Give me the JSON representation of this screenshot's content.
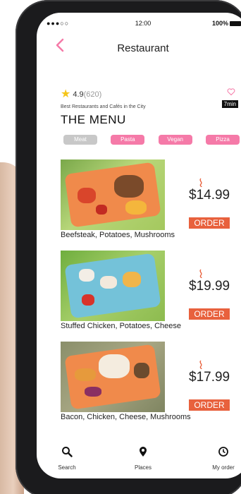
{
  "status_bar": {
    "signal": "●●●○○",
    "time": "12:00",
    "battery": "100%"
  },
  "header": {
    "title": "Restaurant"
  },
  "restaurant": {
    "rating": "4.9",
    "rating_count": "(620)",
    "tagline": "Best Restaurants and Cafés in the City",
    "wait_time": "7min",
    "menu_title": "THE MENU"
  },
  "categories": [
    {
      "label": "Meat",
      "active": false
    },
    {
      "label": "Pasta",
      "active": true
    },
    {
      "label": "Vegan",
      "active": true
    },
    {
      "label": "Pizza",
      "active": true
    }
  ],
  "menu_items": [
    {
      "price": "$14.99",
      "order_label": "ORDER",
      "name": "Beefsteak, Potatoes, Mushrooms"
    },
    {
      "price": "$19.99",
      "order_label": "ORDER",
      "name": "Stuffed Chicken, Potatoes, Cheese"
    },
    {
      "price": "$17.99",
      "order_label": "ORDER",
      "name": "Bacon, Chicken, Cheese, Mushrooms"
    }
  ],
  "tab_bar": [
    {
      "label": "Search",
      "icon": "search-icon"
    },
    {
      "label": "Places",
      "icon": "location-pin-icon"
    },
    {
      "label": "My order",
      "icon": "clock-icon"
    }
  ],
  "colors": {
    "accent_pink": "#f57aa8",
    "order_orange": "#e8613d",
    "chip_inactive": "#c8c8c8"
  }
}
